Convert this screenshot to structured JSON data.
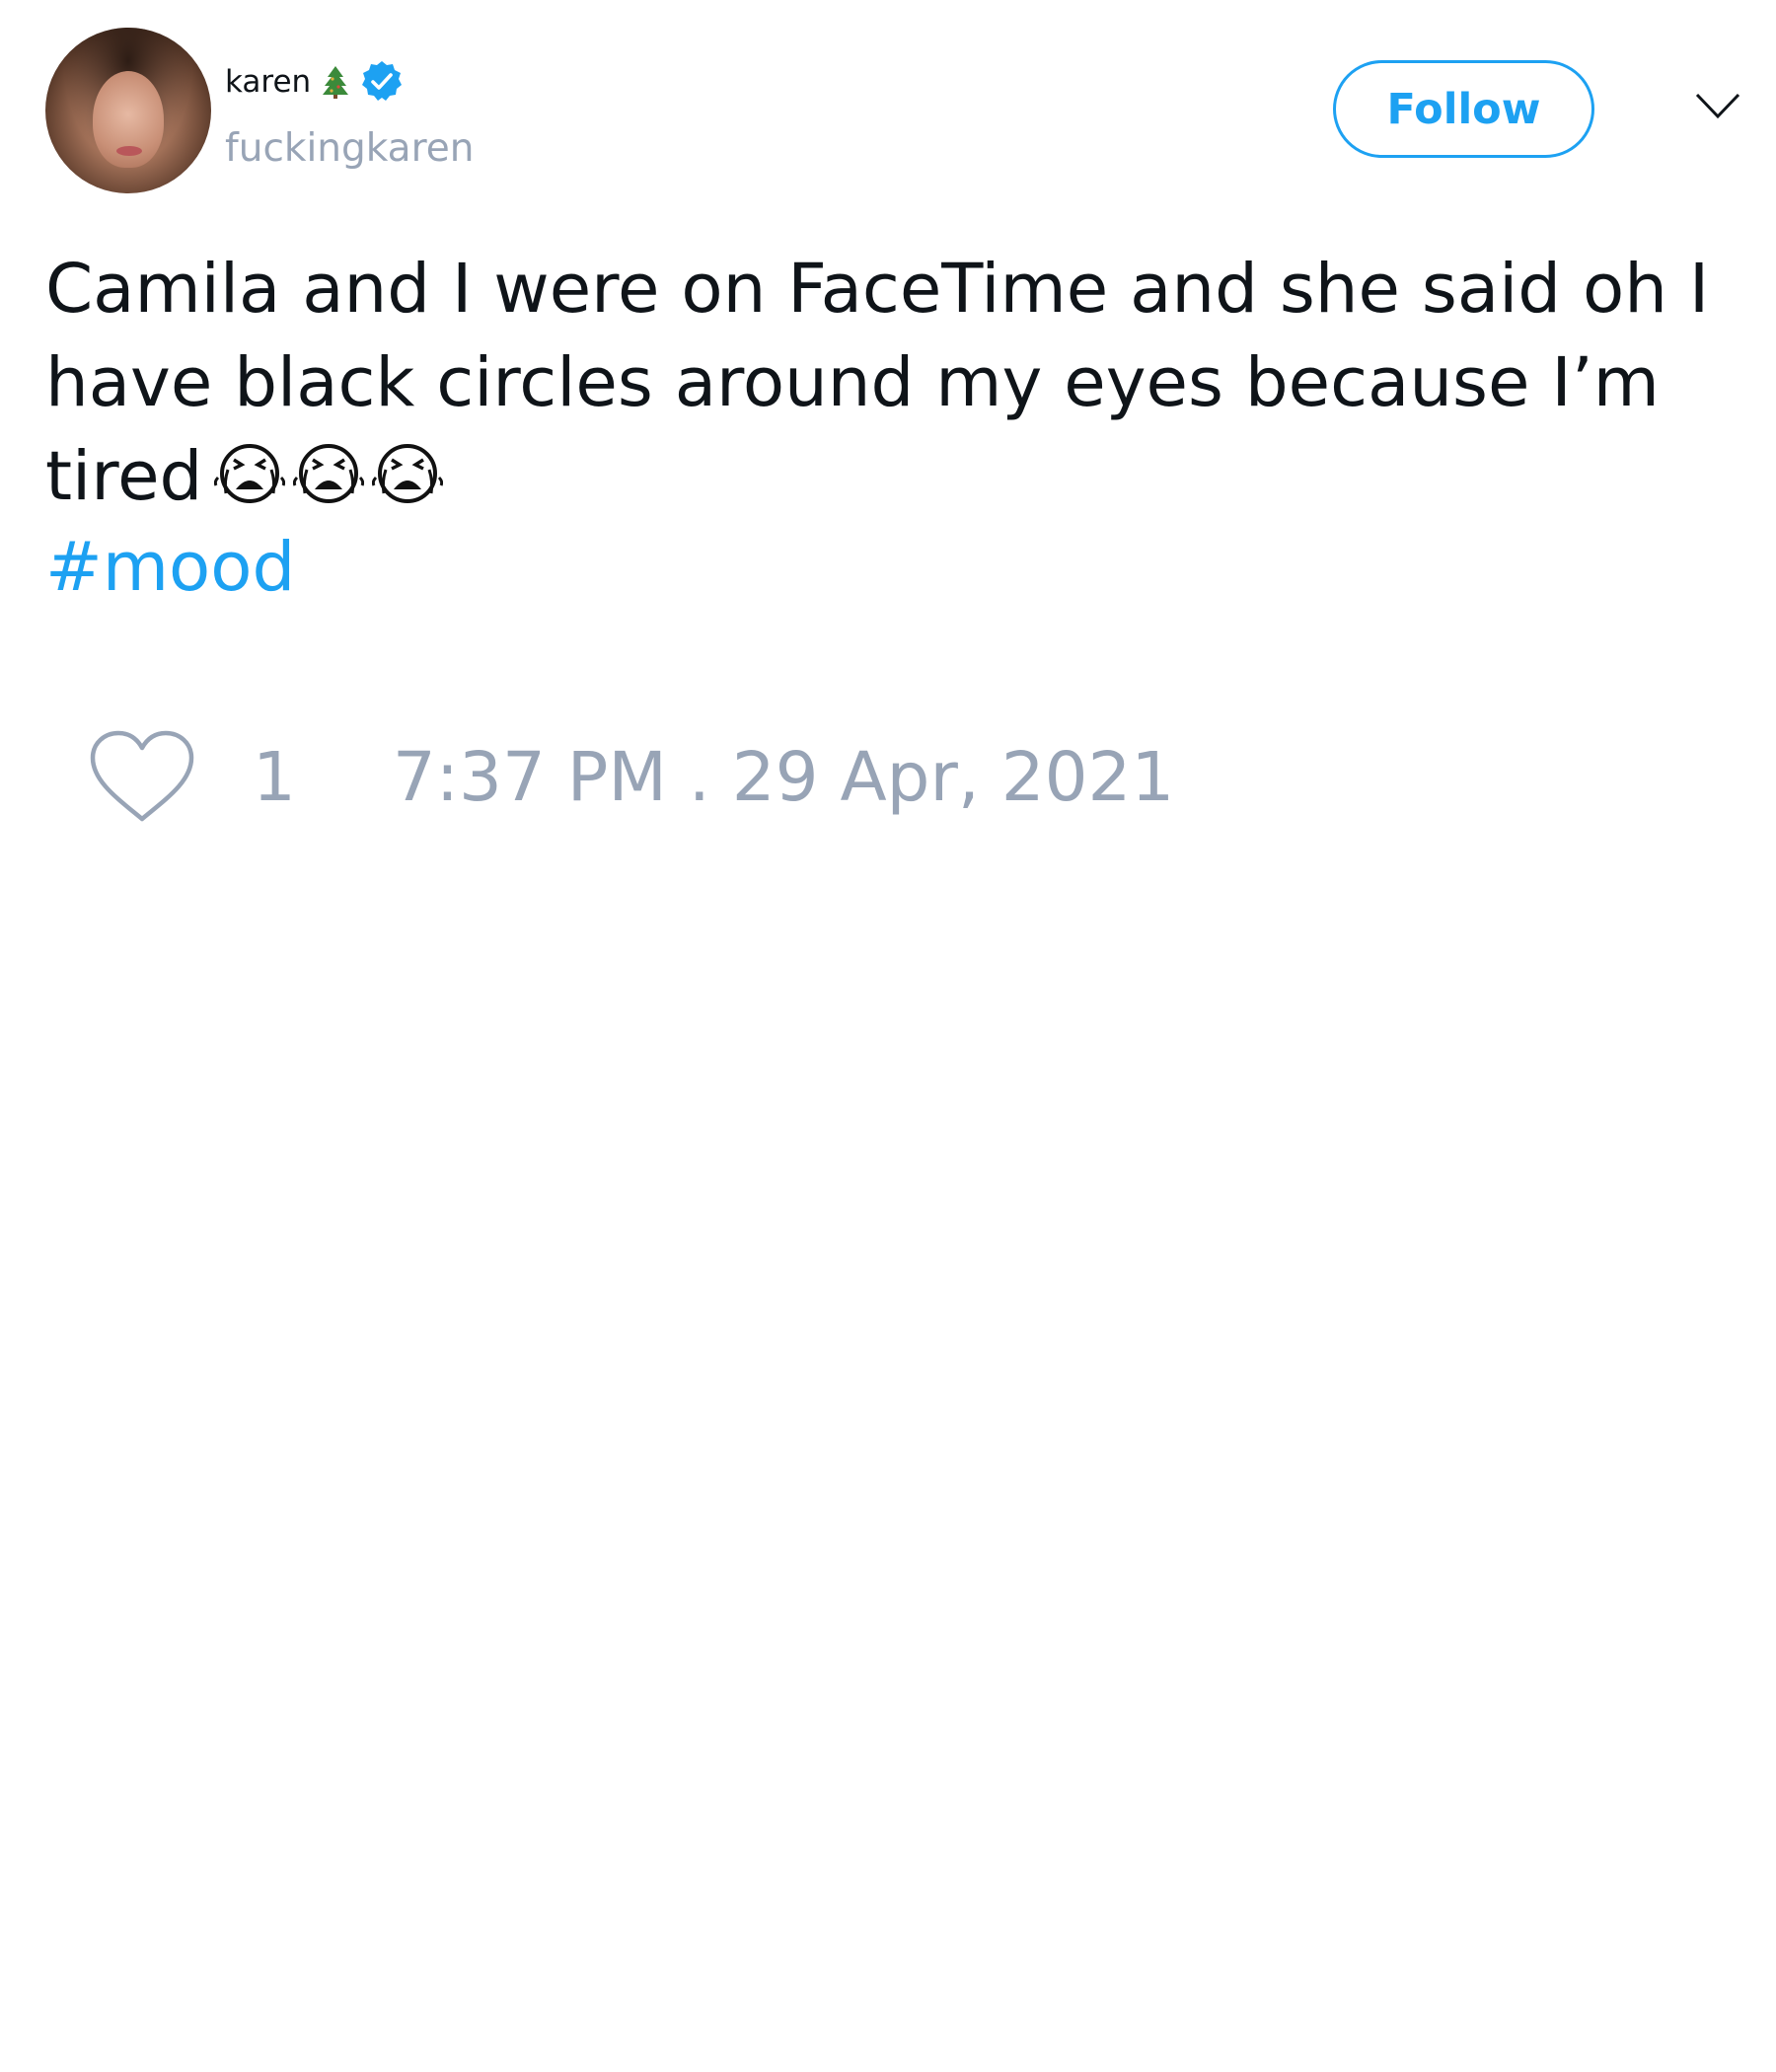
{
  "tweet": {
    "author": {
      "display_name": "karen",
      "handle": "fuckingkaren",
      "name_emoji": "christmas-tree-icon",
      "verified": true,
      "verified_icon": "verified-badge-icon"
    },
    "follow_label": "Follow",
    "menu_icon": "chevron-down-icon",
    "text": "Camila and I were on FaceTime and she said oh I have black circles around my eyes because I’m tired",
    "emojis": [
      "loudly-crying-face-icon",
      "loudly-crying-face-icon",
      "loudly-crying-face-icon"
    ],
    "hashtag": "#mood",
    "likes": "1",
    "like_icon": "heart-icon",
    "timestamp": "7:37 PM . 29 Apr, 2021"
  },
  "colors": {
    "accent": "#1da1f2",
    "muted": "#98a4b6",
    "text": "#0f1419",
    "background": "#ffffff"
  }
}
